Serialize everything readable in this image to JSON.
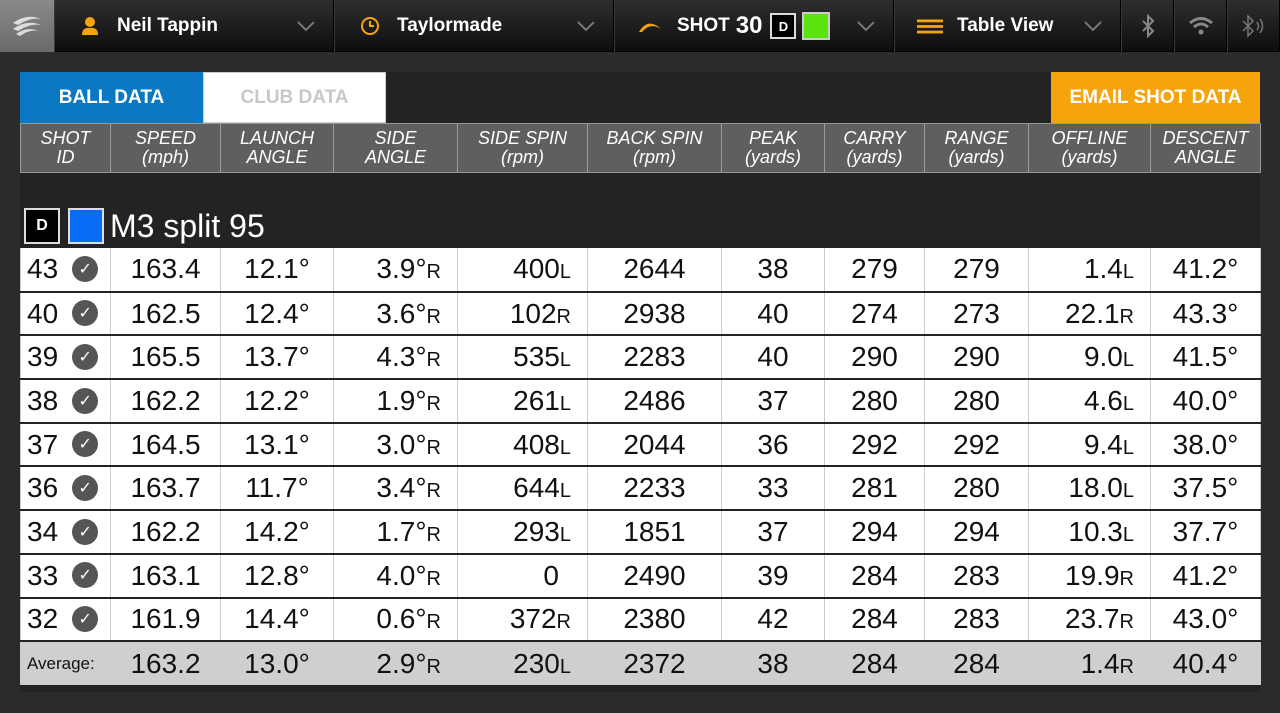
{
  "topbar": {
    "user": "Neil Tappin",
    "club_set": "Taylormade",
    "shot_label": "SHOT",
    "shot_number": "30",
    "shot_badge": "D",
    "shot_color": "#5ae40b",
    "view": "Table View"
  },
  "tabs": {
    "ball_data": "BALL DATA",
    "club_data": "CLUB DATA"
  },
  "email_button": "EMAIL SHOT DATA",
  "columns": [
    {
      "l1": "SHOT",
      "l2": "ID"
    },
    {
      "l1": "SPEED",
      "l2": "(mph)"
    },
    {
      "l1": "LAUNCH",
      "l2": "ANGLE"
    },
    {
      "l1": "SIDE",
      "l2": "ANGLE"
    },
    {
      "l1": "SIDE SPIN",
      "l2": "(rpm)"
    },
    {
      "l1": "BACK SPIN",
      "l2": "(rpm)"
    },
    {
      "l1": "PEAK",
      "l2": "(yards)"
    },
    {
      "l1": "CARRY",
      "l2": "(yards)"
    },
    {
      "l1": "RANGE",
      "l2": "(yards)"
    },
    {
      "l1": "OFFLINE",
      "l2": "(yards)"
    },
    {
      "l1": "DESCENT",
      "l2": "ANGLE"
    }
  ],
  "group": {
    "badge": "D",
    "color": "#0a6cf5",
    "name": "M3 split 95"
  },
  "rows": [
    {
      "id": "43",
      "speed": "163.4",
      "launch": "12.1°",
      "side": "3.9°",
      "side_dir": "R",
      "sidespin": "400",
      "sidespin_dir": "L",
      "backspin": "2644",
      "peak": "38",
      "carry": "279",
      "range": "279",
      "offline": "1.4",
      "offline_dir": "L",
      "descent": "41.2°"
    },
    {
      "id": "40",
      "speed": "162.5",
      "launch": "12.4°",
      "side": "3.6°",
      "side_dir": "R",
      "sidespin": "102",
      "sidespin_dir": "R",
      "backspin": "2938",
      "peak": "40",
      "carry": "274",
      "range": "273",
      "offline": "22.1",
      "offline_dir": "R",
      "descent": "43.3°"
    },
    {
      "id": "39",
      "speed": "165.5",
      "launch": "13.7°",
      "side": "4.3°",
      "side_dir": "R",
      "sidespin": "535",
      "sidespin_dir": "L",
      "backspin": "2283",
      "peak": "40",
      "carry": "290",
      "range": "290",
      "offline": "9.0",
      "offline_dir": "L",
      "descent": "41.5°"
    },
    {
      "id": "38",
      "speed": "162.2",
      "launch": "12.2°",
      "side": "1.9°",
      "side_dir": "R",
      "sidespin": "261",
      "sidespin_dir": "L",
      "backspin": "2486",
      "peak": "37",
      "carry": "280",
      "range": "280",
      "offline": "4.6",
      "offline_dir": "L",
      "descent": "40.0°"
    },
    {
      "id": "37",
      "speed": "164.5",
      "launch": "13.1°",
      "side": "3.0°",
      "side_dir": "R",
      "sidespin": "408",
      "sidespin_dir": "L",
      "backspin": "2044",
      "peak": "36",
      "carry": "292",
      "range": "292",
      "offline": "9.4",
      "offline_dir": "L",
      "descent": "38.0°"
    },
    {
      "id": "36",
      "speed": "163.7",
      "launch": "11.7°",
      "side": "3.4°",
      "side_dir": "R",
      "sidespin": "644",
      "sidespin_dir": "L",
      "backspin": "2233",
      "peak": "33",
      "carry": "281",
      "range": "280",
      "offline": "18.0",
      "offline_dir": "L",
      "descent": "37.5°"
    },
    {
      "id": "34",
      "speed": "162.2",
      "launch": "14.2°",
      "side": "1.7°",
      "side_dir": "R",
      "sidespin": "293",
      "sidespin_dir": "L",
      "backspin": "1851",
      "peak": "37",
      "carry": "294",
      "range": "294",
      "offline": "10.3",
      "offline_dir": "L",
      "descent": "37.7°"
    },
    {
      "id": "33",
      "speed": "163.1",
      "launch": "12.8°",
      "side": "4.0°",
      "side_dir": "R",
      "sidespin": "0",
      "sidespin_dir": "",
      "backspin": "2490",
      "peak": "39",
      "carry": "284",
      "range": "283",
      "offline": "19.9",
      "offline_dir": "R",
      "descent": "41.2°"
    },
    {
      "id": "32",
      "speed": "161.9",
      "launch": "14.4°",
      "side": "0.6°",
      "side_dir": "R",
      "sidespin": "372",
      "sidespin_dir": "R",
      "backspin": "2380",
      "peak": "42",
      "carry": "284",
      "range": "283",
      "offline": "23.7",
      "offline_dir": "R",
      "descent": "43.0°"
    }
  ],
  "average": {
    "label": "Average:",
    "speed": "163.2",
    "launch": "13.0°",
    "side": "2.9°",
    "side_dir": "R",
    "sidespin": "230",
    "sidespin_dir": "L",
    "backspin": "2372",
    "peak": "38",
    "carry": "284",
    "range": "284",
    "offline": "1.4",
    "offline_dir": "R",
    "descent": "40.4°"
  }
}
